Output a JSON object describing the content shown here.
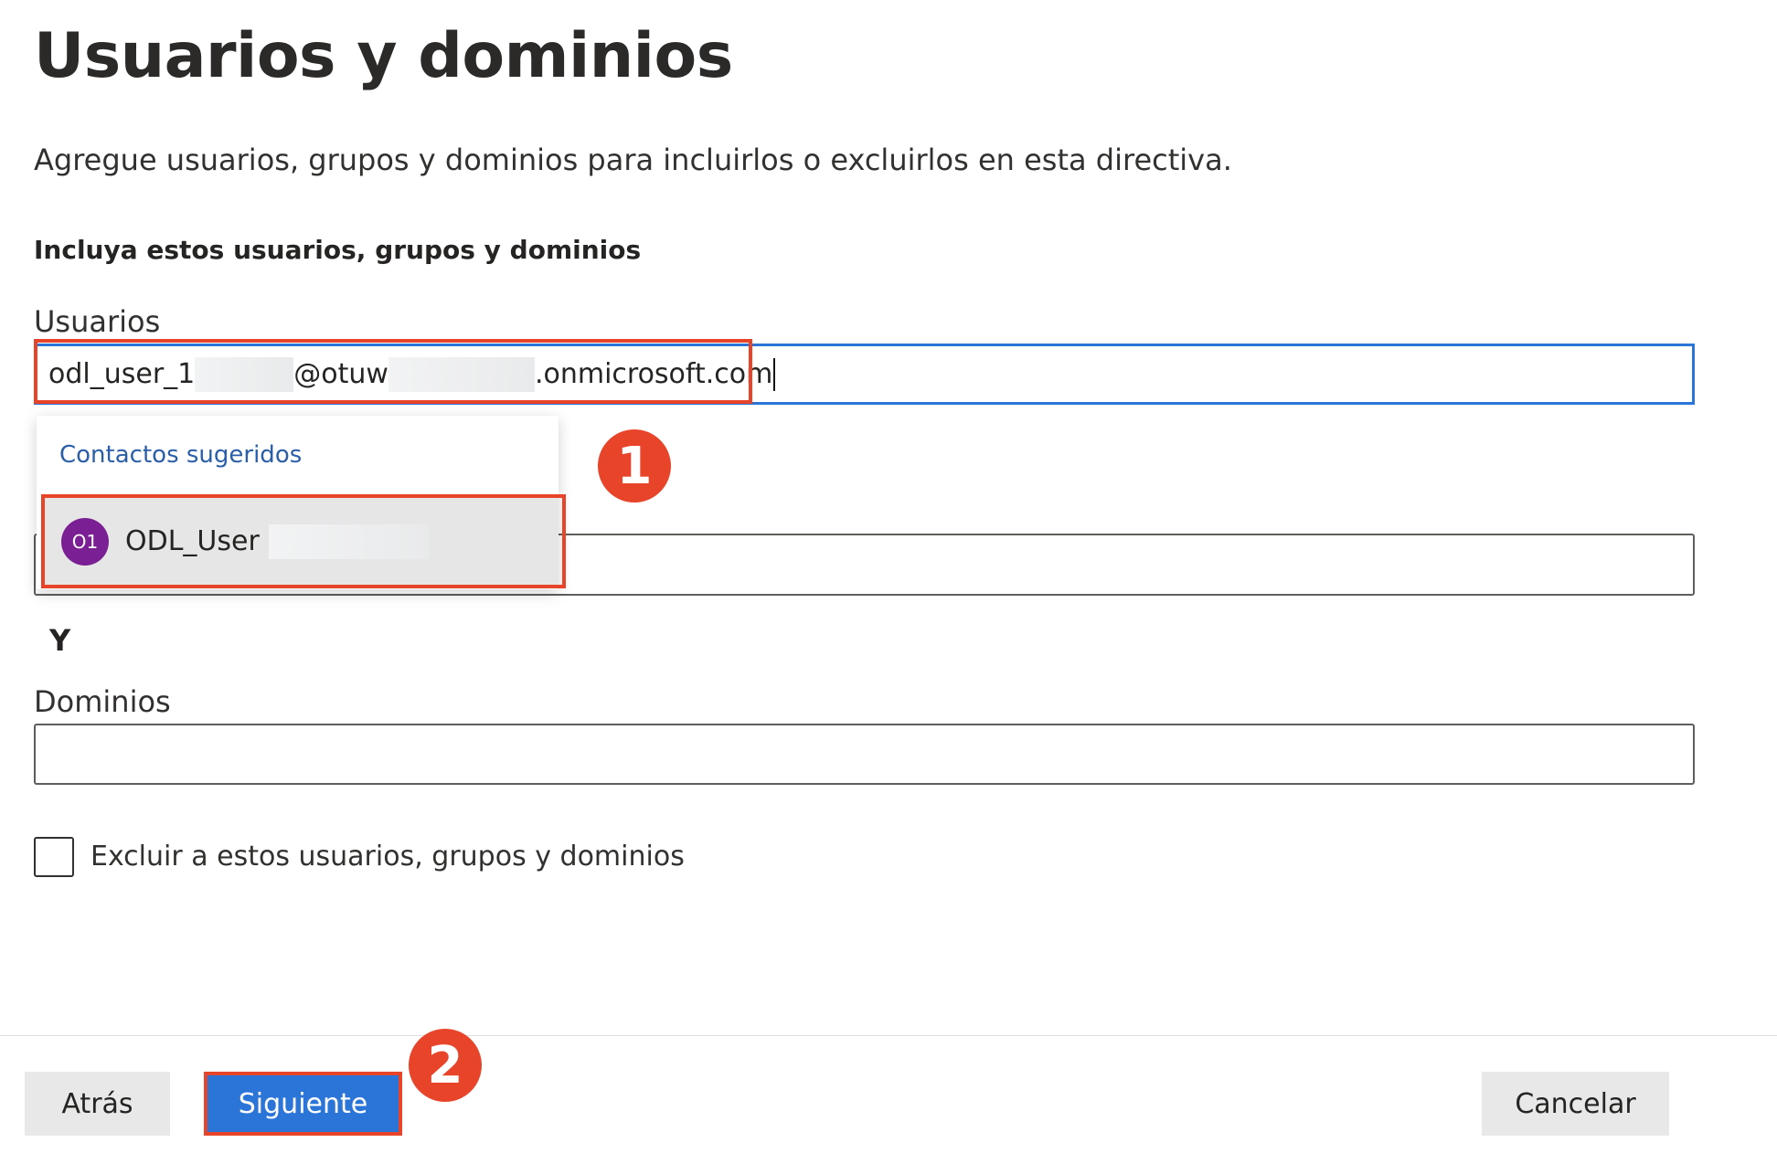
{
  "page": {
    "title": "Usuarios y dominios",
    "description": "Agregue usuarios, grupos y dominios para incluirlos o excluirlos en esta directiva.",
    "section_heading": "Incluya estos usuarios, grupos y dominios"
  },
  "users": {
    "label": "Usuarios",
    "value_parts": [
      "odl_user_1",
      "@otuw",
      ".onmicrosoft.com"
    ]
  },
  "suggestions": {
    "heading": "Contactos sugeridos",
    "items": [
      {
        "initials": "O1",
        "name": "ODL_User",
        "avatar_color": "#7b1f94"
      }
    ]
  },
  "connector": "Y",
  "domains": {
    "label": "Dominios",
    "value": ""
  },
  "exclude": {
    "label": "Excluir a estos usuarios, grupos y dominios",
    "checked": false
  },
  "buttons": {
    "back": "Atrás",
    "next": "Siguiente",
    "cancel": "Cancelar"
  },
  "annotations": {
    "step1": "1",
    "step2": "2",
    "color": "#e8442a"
  },
  "accent": "#2b74d8"
}
